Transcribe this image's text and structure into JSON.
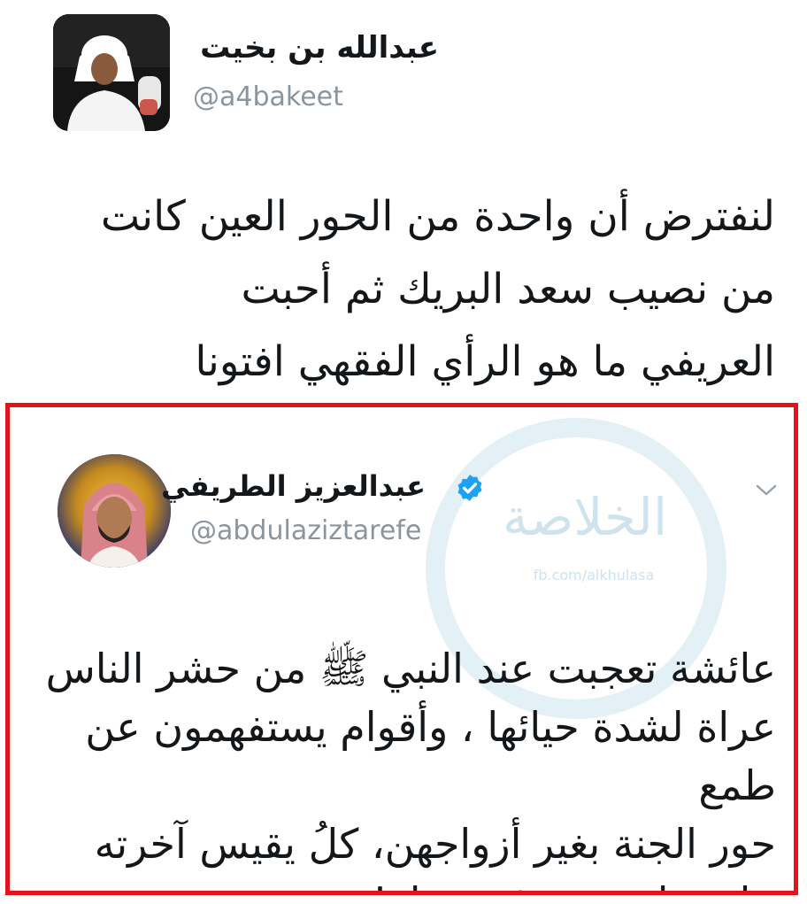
{
  "tweets": [
    {
      "display_name": "عبدالله بن بخيت",
      "handle": "@a4bakeet",
      "avatar_icon": "profile-photo",
      "verified": false,
      "lines": [
        "لنفترض أن واحدة من الحور العين كانت",
        "من نصيب سعد البريك ثم أحبت",
        "العريفي ما هو الرأي الفقهي افتونا"
      ]
    },
    {
      "display_name": "عبدالعزيز الطريفي",
      "handle": "@abdulaziztarefe",
      "avatar_icon": "profile-photo",
      "verified": true,
      "verified_icon": "verified-badge-icon",
      "menu_icon": "chevron-down-icon",
      "lines": [
        "عائشة تعجبت عند النبي ﷺ من حشر الناس",
        "عراة لشدة حيائها ، وأقوام يستفهمون عن طمع",
        "حور الجنة بغير أزواجهن، كلُ يقيس آخرته",
        "على ما يعيشه في دنياه!"
      ]
    }
  ],
  "watermark": {
    "text": "الخلاصة",
    "url": "fb.com/alkhulasa"
  },
  "colors": {
    "highlight_border": "#e3121b",
    "verified_blue": "#1da1f2",
    "handle_gray": "#8b959e",
    "watermark": "#d9ecf4"
  }
}
